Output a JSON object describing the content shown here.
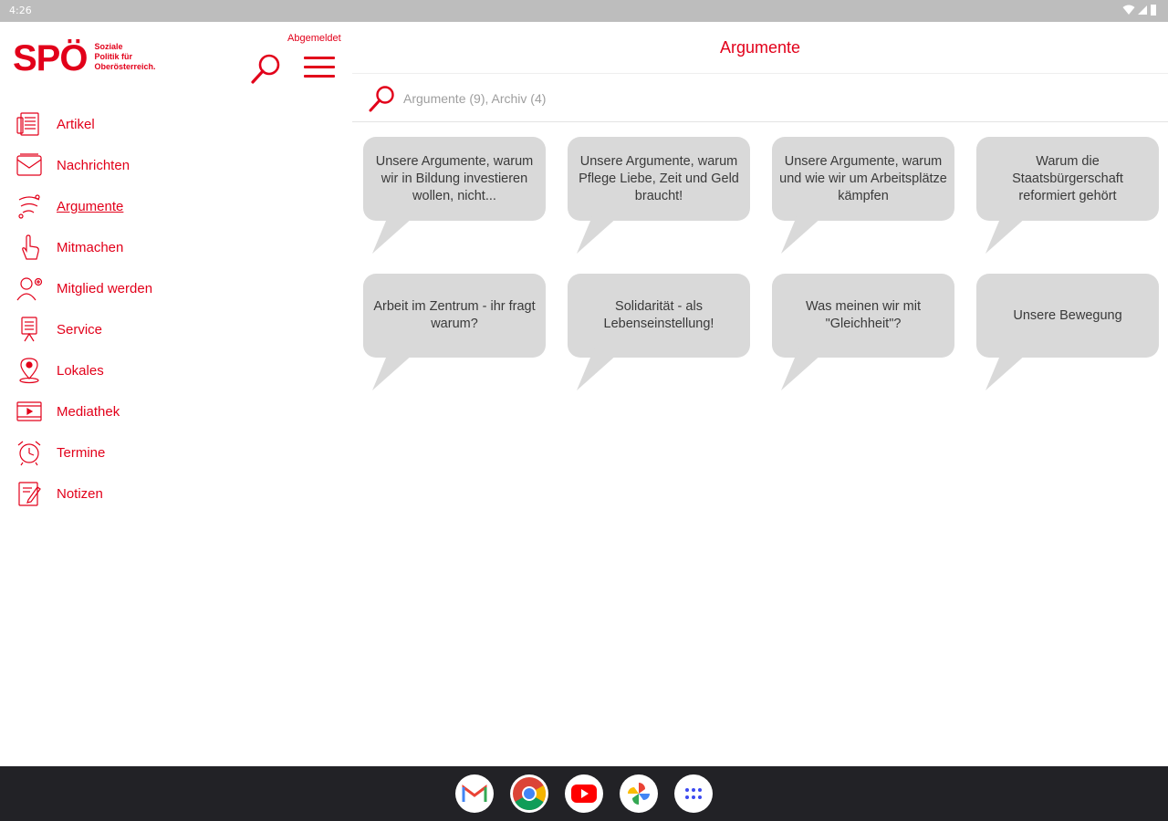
{
  "status_bar": {
    "time": "4:26"
  },
  "sidebar": {
    "logo_text": "SPÖ",
    "logo_subtitle": [
      "Soziale",
      "Politik für",
      "Oberösterreich."
    ],
    "login_status": "Abgemeldet",
    "items": [
      {
        "label": "Artikel",
        "icon": "newspaper-icon"
      },
      {
        "label": "Nachrichten",
        "icon": "mail-icon"
      },
      {
        "label": "Argumente",
        "icon": "arguments-icon",
        "active": true
      },
      {
        "label": "Mitmachen",
        "icon": "hand-pointer-icon"
      },
      {
        "label": "Mitglied werden",
        "icon": "add-member-icon"
      },
      {
        "label": "Service",
        "icon": "service-icon"
      },
      {
        "label": "Lokales",
        "icon": "location-pin-icon"
      },
      {
        "label": "Mediathek",
        "icon": "video-icon"
      },
      {
        "label": "Termine",
        "icon": "alarm-clock-icon"
      },
      {
        "label": "Notizen",
        "icon": "notes-icon"
      }
    ]
  },
  "main": {
    "title": "Argumente",
    "search_placeholder": "Argumente (9), Archiv (4)",
    "cards": [
      "Unsere Argumente, warum wir in Bildung investieren wollen, nicht...",
      "Unsere Argumente, warum Pflege Liebe, Zeit und Geld braucht!",
      "Unsere Argumente, warum und wie wir um Arbeitsplätze kämpfen",
      "Warum die Staatsbürgerschaft reformiert gehört",
      "Arbeit im Zentrum - ihr fragt warum?",
      "Solidarität - als Lebenseinstellung!",
      "Was meinen wir mit \"Gleichheit\"?",
      "Unsere Bewegung"
    ]
  },
  "colors": {
    "accent": "#e2001a",
    "bubble": "#d9d9d9",
    "navbar": "#222226"
  },
  "dock": [
    "gmail-icon",
    "chrome-icon",
    "youtube-icon",
    "photos-icon",
    "apps-icon"
  ]
}
